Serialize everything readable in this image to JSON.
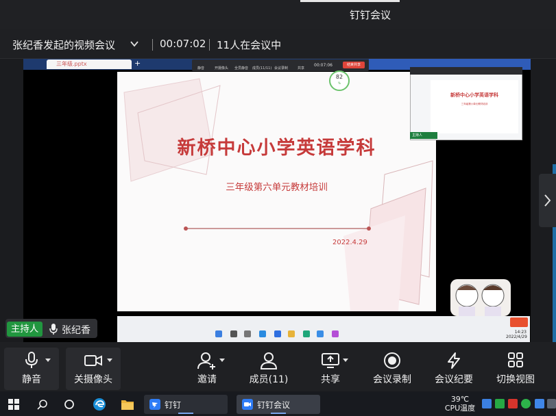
{
  "window": {
    "title": "钉钉会议"
  },
  "meeting": {
    "name": "张纪香发起的视频会议",
    "time": "00:07:02",
    "participants_text": "11人在会议中"
  },
  "shared_screen": {
    "tab_title": "三年级.pptx",
    "toolbar_items": [
      "静音",
      "开摄像头",
      "全员静音",
      "成员(11/11)",
      "会议录制",
      "共享"
    ],
    "toolbar_time": "00:07:06",
    "toolbar_end": "结束共享",
    "progress_percent": 82,
    "progress_label": "82",
    "slide": {
      "title": "新桥中心小学英语学科",
      "subtitle": "三年级第六单元教材培训",
      "date": "2022.4.29"
    },
    "thumbnail": {
      "title": "新桥中心小学英语学科",
      "subtitle": "三年级第六单元教材培训",
      "label": "主持人"
    },
    "desktop_clock": {
      "time": "14:23",
      "date": "2022/4/29"
    }
  },
  "host": {
    "tag": "主持人",
    "name": "张纪香"
  },
  "toolbar": {
    "mute": "静音",
    "camera": "关摄像头",
    "invite": "邀请",
    "members": "成员(11)",
    "share": "共享",
    "record": "会议录制",
    "minutes": "会议纪要",
    "layout": "切换视图"
  },
  "taskbar": {
    "apps": [
      {
        "label": "钉钉"
      },
      {
        "label": "钉钉会议"
      }
    ],
    "temperature": "39℃",
    "temperature_label": "CPU温度"
  },
  "colors": {
    "accent_green": "#21963f",
    "slide_red": "#c63a3a",
    "record_red": "#e0453a",
    "taskbar_blue": "#3b7fe0"
  }
}
